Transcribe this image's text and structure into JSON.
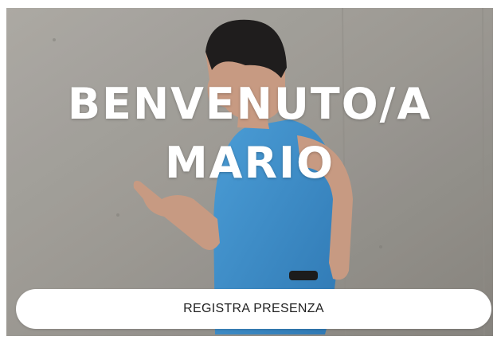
{
  "welcome": {
    "line1": "BENVENUTO/A",
    "line2": "MARIO"
  },
  "checkin_button": {
    "label": "REGISTRA PRESENZA"
  },
  "background": {
    "icon": "runner-photo",
    "wall_color": "#a9a7a2",
    "shirt_color": "#3f8fc9",
    "skin_color": "#c79a82",
    "hair_color": "#1f1d1d"
  }
}
